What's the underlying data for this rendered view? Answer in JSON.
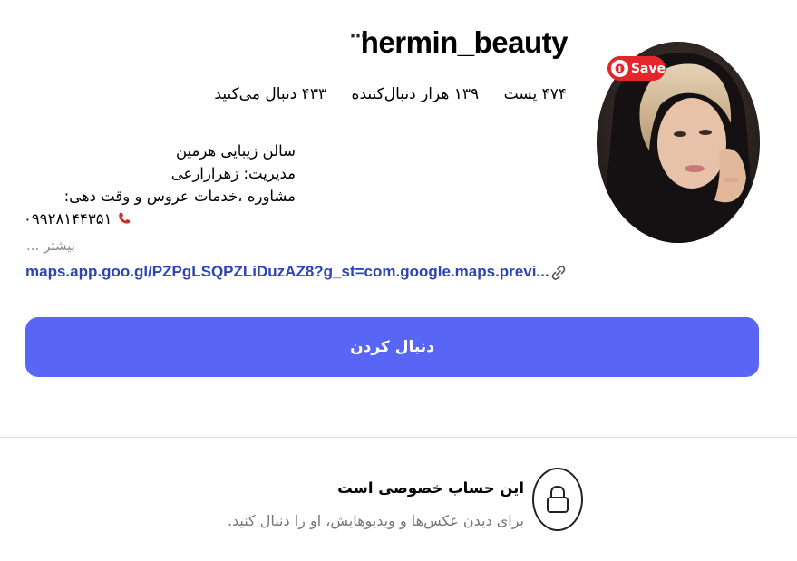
{
  "profile": {
    "username": "hermin_beauty",
    "more_icon": "⋯",
    "stats": {
      "posts": "۴۷۴ پست",
      "followers": "۱۳۹ هزار دنبال‌کننده",
      "following": "۴۳۳ دنبال می‌کنید"
    },
    "save_badge": "Save",
    "bio": {
      "line1": "سالن زیبایی هرمین",
      "line2": "مدیریت: زهرازارعی",
      "line3": "مشاوره ،خدمات عروس و وقت دهی:",
      "line4": "۰۹۹۲۸۱۴۴۳۵۱",
      "phone_icon": "phone-icon",
      "more": "بیشتر ..."
    },
    "link": "maps.app.goo.gl/PZPgLSQPZLiDuzAZ8?g_st=com.google.maps.previ...",
    "follow_button": "دنبال کردن"
  },
  "private_notice": {
    "title": "این حساب خصوصی است",
    "description": "برای دیدن عکس‌ها و ویدیوهایش، او را دنبال کنید."
  },
  "colors": {
    "follow_button": "#5865f5",
    "link": "#2d44b8",
    "save_badge": "#e4252c"
  }
}
